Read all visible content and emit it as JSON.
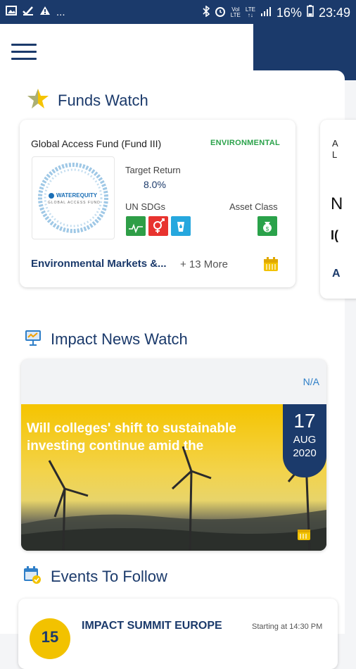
{
  "status_bar": {
    "left_icons": [
      "image-icon",
      "check-icon",
      "warning-icon"
    ],
    "left_ellipsis": "...",
    "vol": "Vol",
    "lte1": "LTE",
    "lte2": "LTE",
    "battery": "16%",
    "time": "23:49"
  },
  "funds_watch": {
    "title": "Funds Watch",
    "card": {
      "fund_name": "Global Access Fund (Fund III)",
      "tag": "ENVIRONMENTAL",
      "logo_text": "WATEREQUITY",
      "logo_subtext": "GLOBAL ACCESS FUND",
      "target_return_label": "Target Return",
      "target_return_value": "8.0%",
      "un_sdgs_label": "UN SDGs",
      "asset_class_label": "Asset Class",
      "sdgs": [
        {
          "num": "3",
          "color": "#2e9e47"
        },
        {
          "num": "5",
          "color": "#e8332f"
        },
        {
          "num": "6",
          "color": "#26a7de"
        }
      ],
      "footer_category": "Environmental Markets &...",
      "footer_more": "+ 13 More",
      "asset_icon_color": "#2aa24a"
    },
    "peek_card_chars": [
      "A",
      "L",
      "N",
      "I(",
      "A"
    ]
  },
  "impact_news": {
    "title": "Impact News Watch",
    "status": "N/A",
    "headline": "Will colleges' shift to sustainable investing continue amid the",
    "date": {
      "day": "17",
      "month": "AUG",
      "year": "2020"
    }
  },
  "events": {
    "title": "Events To Follow",
    "event": {
      "badge_day": "15",
      "name": "IMPACT SUMMIT EUROPE",
      "time": "Starting at 14:30 PM"
    }
  }
}
